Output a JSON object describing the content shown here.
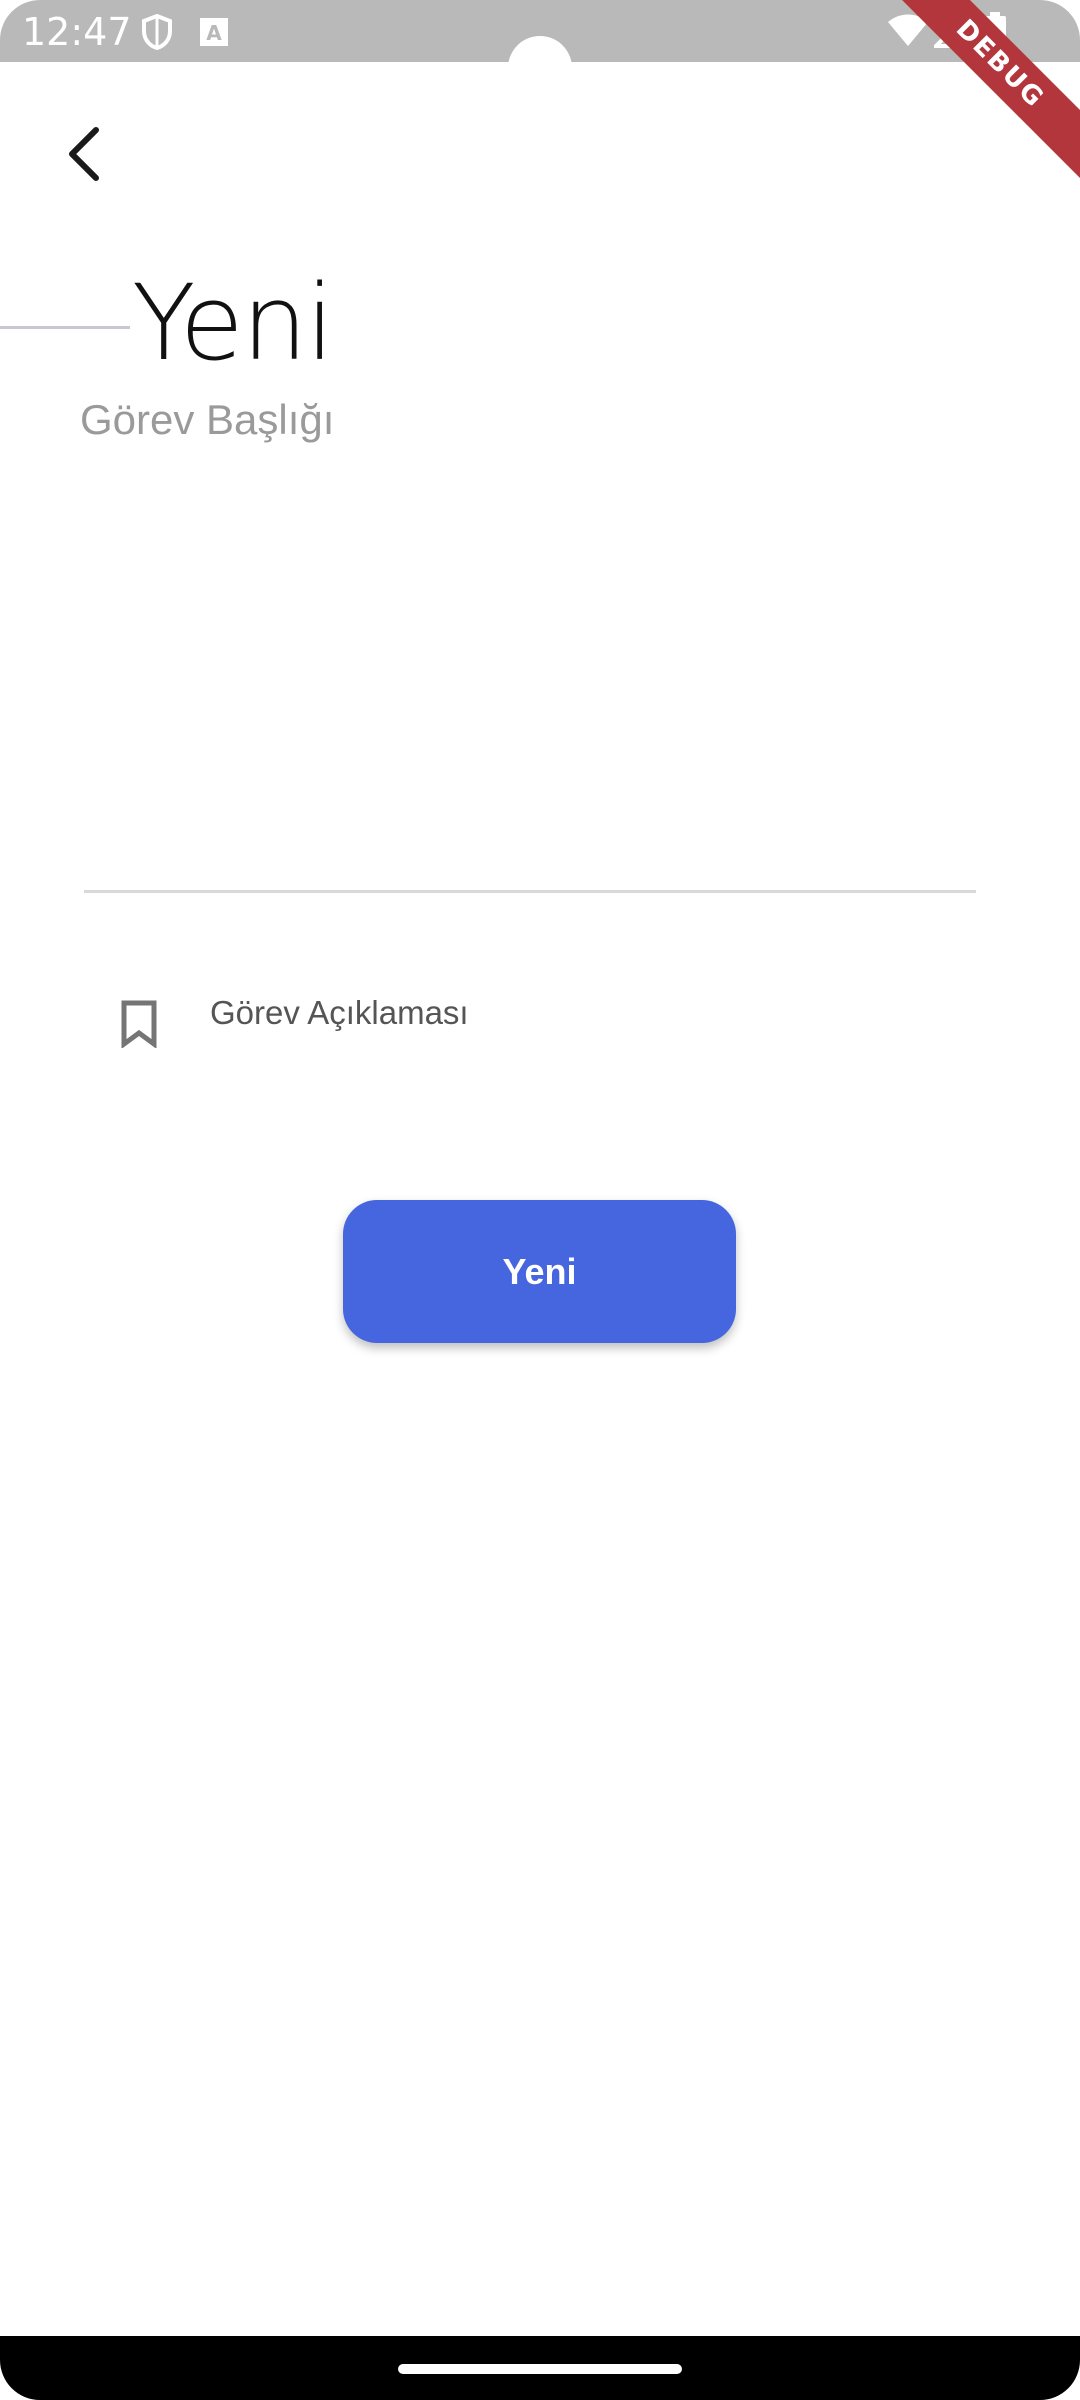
{
  "status_bar": {
    "time": "12:47",
    "icons_left": [
      "shield-icon",
      "keyboard-a-icon"
    ],
    "icons_right": [
      "wifi-icon",
      "signal-icon",
      "battery-icon"
    ]
  },
  "debug_banner": "DEBUG",
  "header": {
    "back_icon": "chevron-left-icon",
    "title": "Yeni"
  },
  "form": {
    "title_label": "Görev Başlığı",
    "title_value": "",
    "description_icon": "bookmark-icon",
    "description_label": "Görev Açıklaması",
    "description_value": ""
  },
  "actions": {
    "submit_label": "Yeni"
  },
  "colors": {
    "accent": "#4666DF",
    "status_bar": "#B9B9B9",
    "debug": "#B3363D"
  }
}
